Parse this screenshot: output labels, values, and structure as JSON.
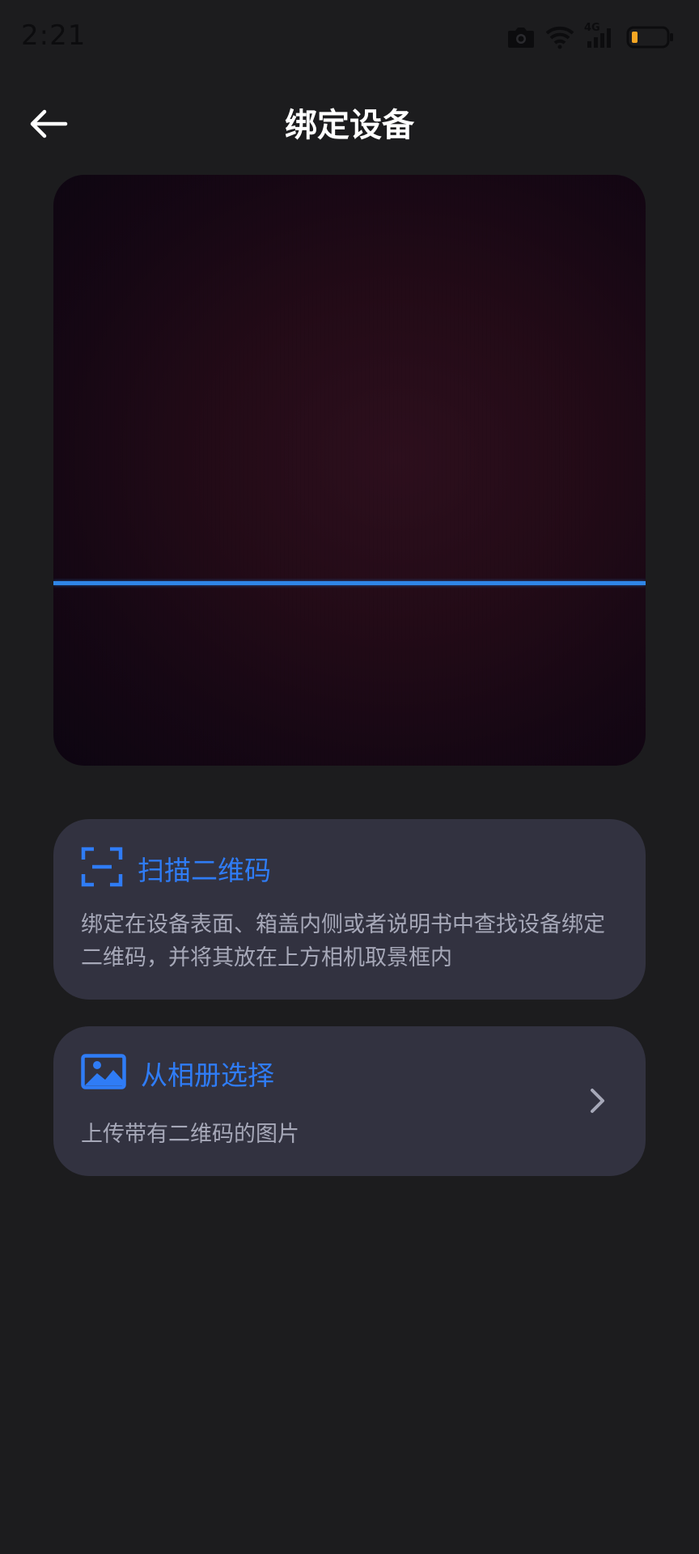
{
  "status_bar": {
    "time": "2:21",
    "icons": [
      "camera-icon",
      "wifi-icon",
      "signal-4g-icon",
      "battery-icon"
    ],
    "network_label": "4G",
    "battery_color": "#f5a623"
  },
  "header": {
    "back_icon": "arrow-left-icon",
    "title": "绑定设备"
  },
  "viewfinder": {
    "scan_line_color": "#2f86e8"
  },
  "scan_card": {
    "icon": "scan-frame-icon",
    "title": "扫描二维码",
    "description": "绑定在设备表面、箱盖内侧或者说明书中查找设备绑定二维码，并将其放在上方相机取景框内"
  },
  "album_card": {
    "icon": "image-icon",
    "title": "从相册选择",
    "description": "上传带有二维码的图片",
    "chevron_icon": "chevron-right-icon"
  },
  "colors": {
    "background": "#1c1c1e",
    "card_background": "#323240",
    "accent": "#2f7cf6",
    "secondary_text": "#a6a8b8"
  }
}
